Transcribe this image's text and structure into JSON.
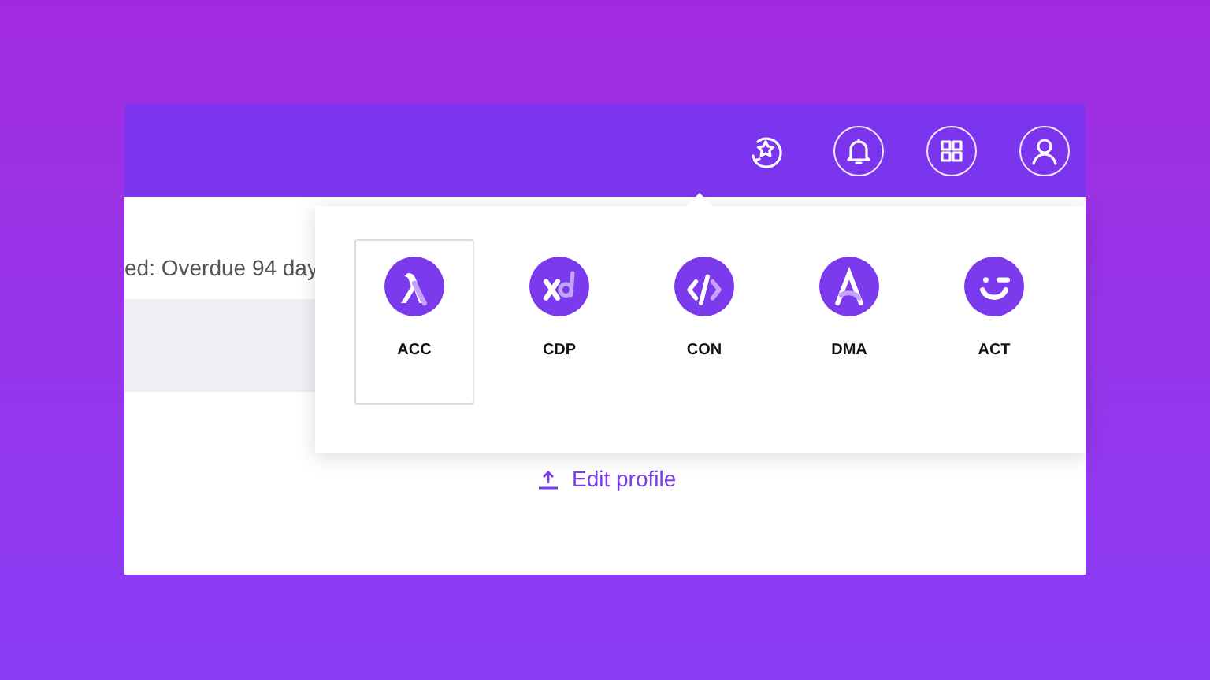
{
  "header": {
    "icons": [
      {
        "kind": "favorites"
      },
      {
        "kind": "notifications"
      },
      {
        "kind": "apps"
      },
      {
        "kind": "profile"
      }
    ]
  },
  "content": {
    "status_text": "ed: Overdue 94 day",
    "link": "Edit profile"
  },
  "apps_menu": {
    "items": [
      {
        "label": "ACC",
        "kind": "acc",
        "selected": true
      },
      {
        "label": "CDP",
        "kind": "cdp",
        "selected": false
      },
      {
        "label": "CON",
        "kind": "con",
        "selected": false
      },
      {
        "label": "DMA",
        "kind": "dma",
        "selected": false
      },
      {
        "label": "ACT",
        "kind": "act",
        "selected": false
      }
    ]
  }
}
